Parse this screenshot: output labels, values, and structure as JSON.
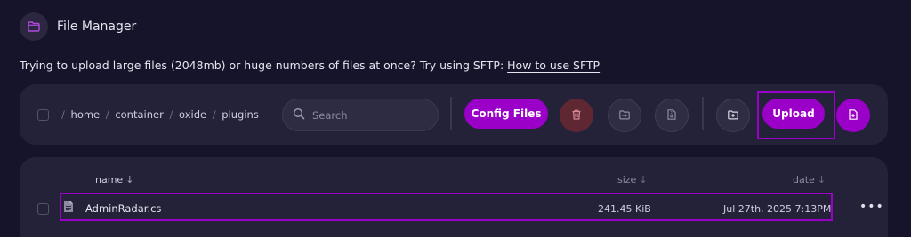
{
  "app": {
    "title": "File Manager",
    "icon": "folder-icon",
    "accent_color": "#9a00c8"
  },
  "notice": {
    "text": "Trying to upload large files (2048mb) or huge numbers of files at once? Try using SFTP:",
    "link_label": "How to use SFTP"
  },
  "toolbar": {
    "path_segments": [
      "home",
      "container",
      "oxide",
      "plugins"
    ],
    "search_placeholder": "Search",
    "config_files_label": "Config Files",
    "delete_icon": "trash-icon",
    "move_icon": "move-file-icon",
    "archive_icon": "archive-file-icon",
    "new_folder_icon": "new-folder-icon",
    "upload_label": "Upload",
    "new_file_icon": "new-file-icon"
  },
  "table": {
    "columns": [
      {
        "label": "name",
        "sort": "↓"
      },
      {
        "label": "size",
        "sort": "↓"
      },
      {
        "label": "date",
        "sort": "↓"
      }
    ],
    "rows": [
      {
        "name": "AdminRadar.cs",
        "size": "241.45 KiB",
        "date": "Jul 27th, 2025 7:13PM",
        "icon": "file-icon"
      }
    ],
    "row_menu_label": "•••"
  }
}
